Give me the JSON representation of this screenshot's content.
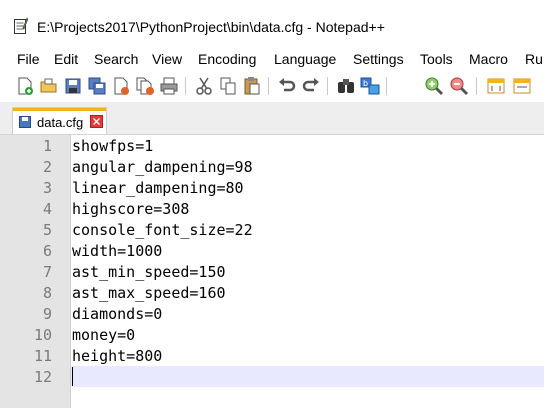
{
  "window": {
    "title": "E:\\Projects2017\\PythonProject\\bin\\data.cfg - Notepad++"
  },
  "menu": [
    {
      "label": "File"
    },
    {
      "label": "Edit"
    },
    {
      "label": "Search"
    },
    {
      "label": "View"
    },
    {
      "label": "Encoding"
    },
    {
      "label": "Language"
    },
    {
      "label": "Settings"
    },
    {
      "label": "Tools"
    },
    {
      "label": "Macro"
    },
    {
      "label": "Ru"
    }
  ],
  "toolbar": {
    "buttons": [
      "new-file-icon",
      "open-file-icon",
      "save-icon",
      "save-all-icon",
      "close-icon",
      "close-all-icon",
      "print-icon",
      "cut-icon",
      "copy-icon",
      "paste-icon",
      "undo-icon",
      "redo-icon",
      "find-icon",
      "replace-icon",
      "zoom-in-icon",
      "zoom-out-icon",
      "sync-vertical-icon",
      "sync-horizontal-icon"
    ]
  },
  "tabs": [
    {
      "label": "data.cfg",
      "active": true
    }
  ],
  "editor": {
    "lines": [
      {
        "num": "1",
        "text": "showfps=1"
      },
      {
        "num": "2",
        "text": "angular_dampening=98"
      },
      {
        "num": "3",
        "text": "linear_dampening=80"
      },
      {
        "num": "4",
        "text": "highscore=308"
      },
      {
        "num": "5",
        "text": "console_font_size=22"
      },
      {
        "num": "6",
        "text": "width=1000"
      },
      {
        "num": "7",
        "text": "ast_min_speed=150"
      },
      {
        "num": "8",
        "text": "ast_max_speed=160"
      },
      {
        "num": "9",
        "text": "diamonds=0"
      },
      {
        "num": "10",
        "text": "money=0"
      },
      {
        "num": "11",
        "text": "height=800"
      },
      {
        "num": "12",
        "text": ""
      }
    ],
    "current_line": "12"
  },
  "colors": {
    "tab_accent": "#f4b31d",
    "current_line_bg": "#e8e8ff",
    "gutter_bg": "#e4e4e4"
  }
}
